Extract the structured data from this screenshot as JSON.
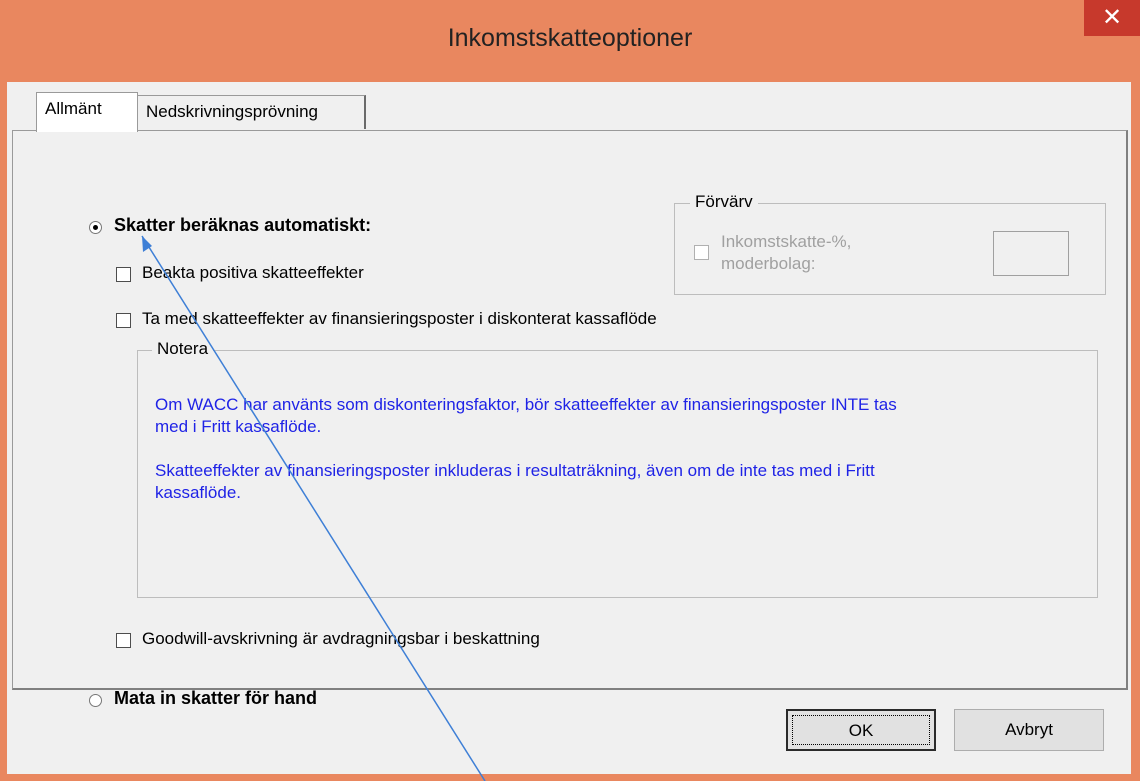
{
  "window": {
    "title": "Inkomstskatteoptioner",
    "close_glyph": "✕"
  },
  "tabs": [
    {
      "label": "Allmänt",
      "selected": true
    },
    {
      "label": "Nedskrivningsprövning",
      "selected": false
    }
  ],
  "options": {
    "auto_radio_label": "Skatter beräknas automatiskt:",
    "manual_radio_label": "Mata in skatter för hand",
    "positive_effects_label": "Beakta positiva skatteeffekter",
    "finance_items_label": "Ta med skatteeffekter av finansieringsposter i diskonterat kassaflöde",
    "goodwill_label": "Goodwill-avskrivning är avdragningsbar i beskattning"
  },
  "acquisition": {
    "legend": "Förvärv",
    "checkbox_label_line1": "Inkomstskatte-%,",
    "checkbox_label_line2": "moderbolag:",
    "input_value": ""
  },
  "note": {
    "legend": "Notera",
    "paragraph1_line1": "Om WACC har använts som diskonteringsfaktor, bör skatteeffekter av finansieringsposter INTE tas",
    "paragraph1_line2": "med i Fritt kassaflöde.",
    "paragraph2_line1": "Skatteeffekter av finansieringsposter inkluderas i resultaträkning, även om de inte tas med i Fritt",
    "paragraph2_line2": "kassaflöde."
  },
  "buttons": {
    "ok_label": "OK",
    "cancel_label": "Avbryt"
  },
  "colors": {
    "title_bar": "#e9875f",
    "close_button": "#c7392c",
    "note_text": "#1f23e6",
    "annotation_arrow": "#3e7fd6"
  },
  "icons": {
    "close": "close-icon",
    "arrow": "annotation-arrow-icon"
  }
}
